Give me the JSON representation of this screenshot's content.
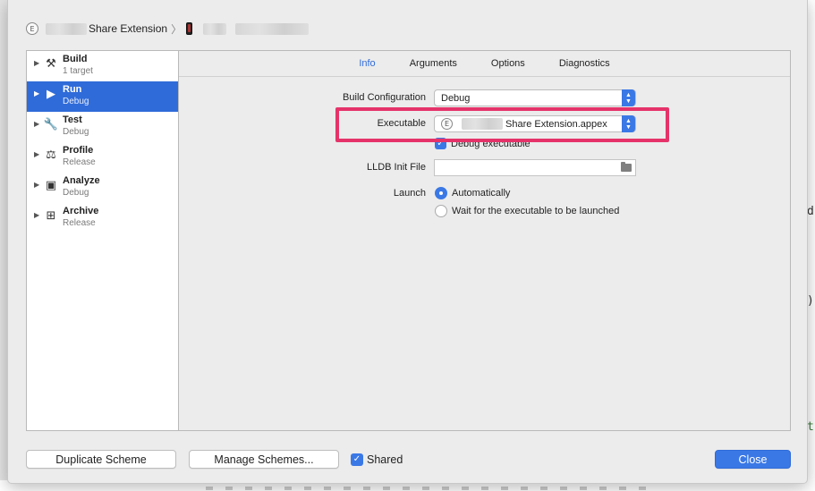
{
  "breadcrumb": {
    "badge": "E",
    "target": "Share Extension",
    "separator": "〉"
  },
  "scheme_actions": [
    {
      "name": "Build",
      "sub": "1 target",
      "icon": "hammer-icon",
      "glyph": "⚒",
      "selected": false
    },
    {
      "name": "Run",
      "sub": "Debug",
      "icon": "play-icon",
      "glyph": "▶",
      "selected": true
    },
    {
      "name": "Test",
      "sub": "Debug",
      "icon": "wrench-icon",
      "glyph": "🔧",
      "selected": false
    },
    {
      "name": "Profile",
      "sub": "Release",
      "icon": "gauge-icon",
      "glyph": "⚖",
      "selected": false
    },
    {
      "name": "Analyze",
      "sub": "Debug",
      "icon": "analyze-icon",
      "glyph": "▣",
      "selected": false
    },
    {
      "name": "Archive",
      "sub": "Release",
      "icon": "archive-icon",
      "glyph": "⊞",
      "selected": false
    }
  ],
  "tabs": [
    {
      "label": "Info",
      "active": true
    },
    {
      "label": "Arguments",
      "active": false
    },
    {
      "label": "Options",
      "active": false
    },
    {
      "label": "Diagnostics",
      "active": false
    }
  ],
  "info": {
    "build_configuration_label": "Build Configuration",
    "build_configuration_value": "Debug",
    "executable_label": "Executable",
    "executable_badge": "E",
    "executable_value": "Share Extension.appex",
    "debug_executable_label": "Debug executable",
    "debug_executable_checked": true,
    "lldb_label": "LLDB Init File",
    "lldb_value": "",
    "launch_label": "Launch",
    "launch_option_auto": "Automatically",
    "launch_option_wait": "Wait for the executable to be launched",
    "launch_selected": "auto"
  },
  "footer": {
    "duplicate_label": "Duplicate Scheme",
    "manage_label": "Manage Schemes...",
    "shared_label": "Shared",
    "shared_checked": true,
    "close_label": "Close"
  },
  "background_editor": {
    "char1": "d",
    "char2": ")",
    "char3": "t"
  },
  "colors": {
    "accent": "#2f6bd9",
    "highlight": "#e5336a"
  }
}
